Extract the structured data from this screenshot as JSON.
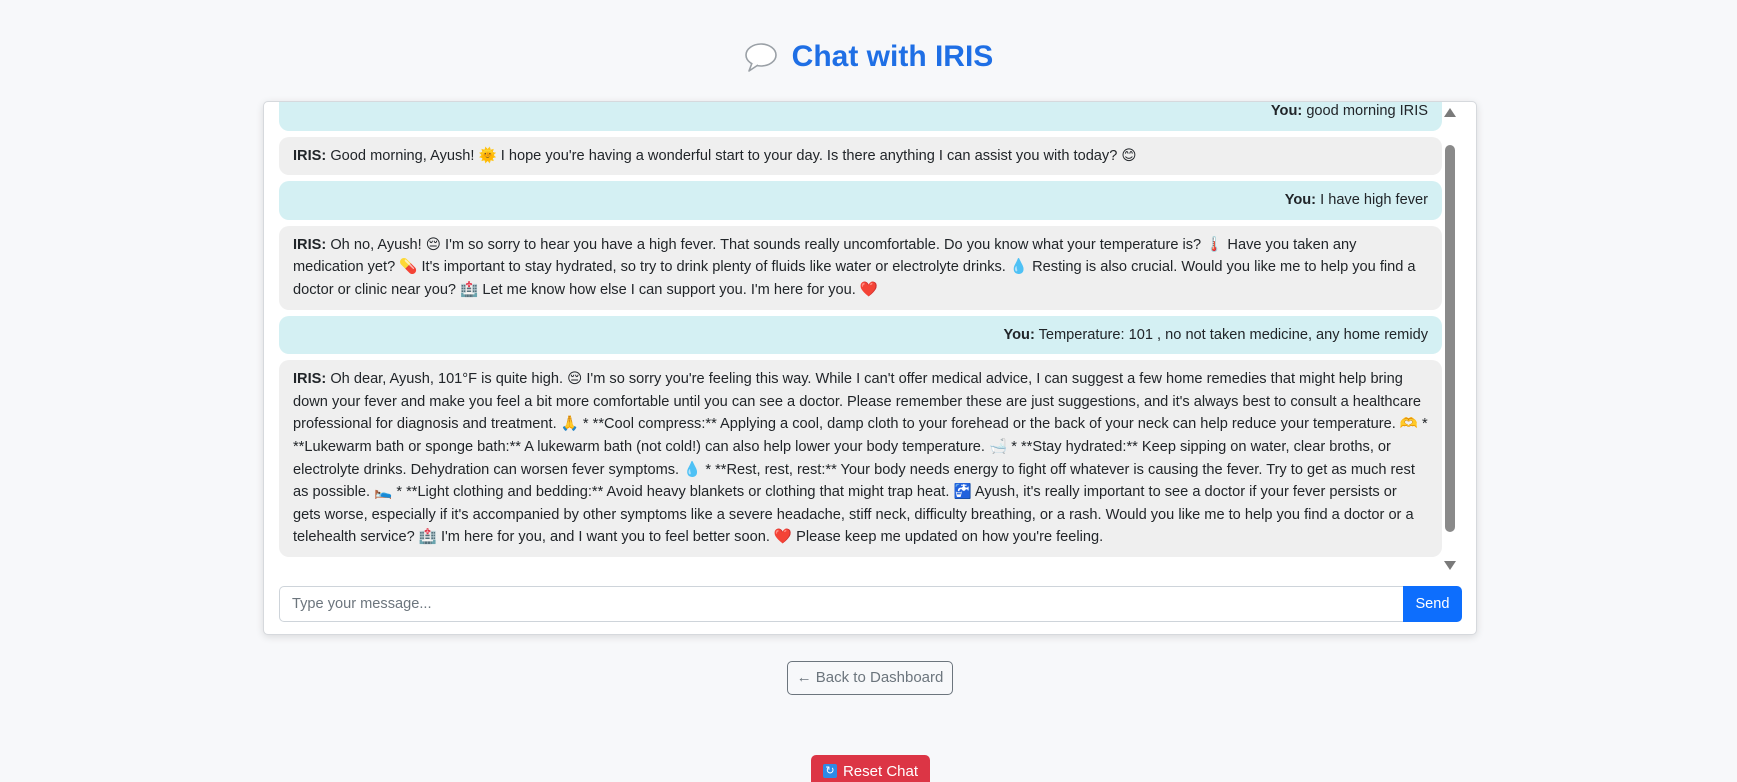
{
  "header": {
    "icon": "speech-bubble-icon",
    "title": "Chat with IRIS"
  },
  "chat": {
    "messages": [
      {
        "role": "user",
        "sender": "You:",
        "text": "good morning IRIS"
      },
      {
        "role": "bot",
        "sender": "IRIS:",
        "text": "Good morning, Ayush! 🌞 I hope you're having a wonderful start to your day. Is there anything I can assist you with today? 😊"
      },
      {
        "role": "user",
        "sender": "You:",
        "text": "I have high fever"
      },
      {
        "role": "bot",
        "sender": "IRIS:",
        "text": "Oh no, Ayush! 😔 I'm so sorry to hear you have a high fever. That sounds really uncomfortable. Do you know what your temperature is? 🌡️ Have you taken any medication yet? 💊 It's important to stay hydrated, so try to drink plenty of fluids like water or electrolyte drinks. 💧 Resting is also crucial. Would you like me to help you find a doctor or clinic near you? 🏥 Let me know how else I can support you. I'm here for you. ❤️"
      },
      {
        "role": "user",
        "sender": "You:",
        "text": "Temperature: 101 , no not taken medicine, any home remidy"
      },
      {
        "role": "bot",
        "sender": "IRIS:",
        "text": "Oh dear, Ayush, 101°F is quite high. 😔 I'm so sorry you're feeling this way. While I can't offer medical advice, I can suggest a few home remedies that might help bring down your fever and make you feel a bit more comfortable until you can see a doctor. Please remember these are just suggestions, and it's always best to consult a healthcare professional for diagnosis and treatment. 🙏 * **Cool compress:** Applying a cool, damp cloth to your forehead or the back of your neck can help reduce your temperature. 🫶 * **Lukewarm bath or sponge bath:** A lukewarm bath (not cold!) can also help lower your body temperature. 🛁 * **Stay hydrated:** Keep sipping on water, clear broths, or electrolyte drinks. Dehydration can worsen fever symptoms. 💧 * **Rest, rest, rest:** Your body needs energy to fight off whatever is causing the fever. Try to get as much rest as possible. 🛌 * **Light clothing and bedding:** Avoid heavy blankets or clothing that might trap heat. 🚰 Ayush, it's really important to see a doctor if your fever persists or gets worse, especially if it's accompanied by other symptoms like a severe headache, stiff neck, difficulty breathing, or a rash. Would you like me to help you find a doctor or a telehealth service? 🏥 I'm here for you, and I want you to feel better soon. ❤️ Please keep me updated on how you're feeling."
      }
    ]
  },
  "input": {
    "placeholder": "Type your message...",
    "value": "",
    "send_label": "Send"
  },
  "nav": {
    "back_label": "← Back to Dashboard",
    "reset_icon": "refresh-icon",
    "reset_label": "Reset Chat"
  },
  "colors": {
    "title": "#1f6fe5",
    "user_bubble": "#d4f0f3",
    "bot_bubble": "#efefef",
    "send_button": "#0d6efd",
    "reset_button": "#dc3545"
  }
}
